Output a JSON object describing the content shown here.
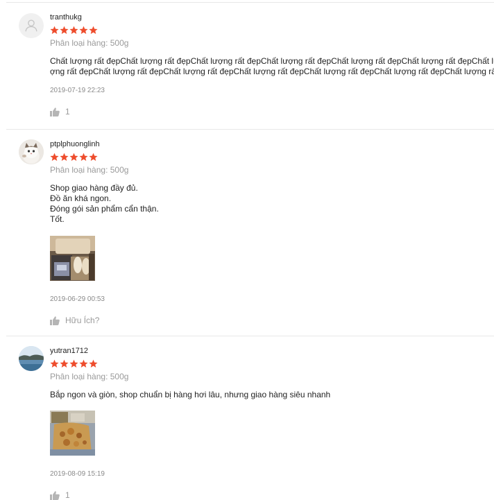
{
  "reviews": [
    {
      "username": "tranthukg",
      "rating": 5,
      "variation": "Phân loại hàng: 500g",
      "comment": "Chất lượng rất đẹpChất lượng rất đẹpChất lượng rất đẹpChất lượng rất đẹpChất lượng rất đẹpChất lượng rất đẹpChất lượng rất đẹpChất lượng rất đẹpChất lượng rất đẹpChất lượng rất đẹpChất lượng rất đẹpChất lượng rất đẹpChất lượng rất đẹpChất lượng rất đẹp",
      "timestamp": "2019-07-19 22:23",
      "like_label": "1",
      "avatar_icon": "default-user-icon"
    },
    {
      "username": "ptplphuonglinh",
      "rating": 5,
      "variation": "Phân loại hàng: 500g",
      "comment": "Shop giao hàng đầy đủ.\nĐồ ăn khá ngon.\nĐóng gói sản phẩm cẩn thận.\nTốt.",
      "timestamp": "2019-06-29 00:53",
      "like_label": "Hữu Ích?",
      "avatar_icon": "cat-avatar"
    },
    {
      "username": "yutran1712",
      "rating": 5,
      "variation": "Phân loại hàng: 500g",
      "comment": "Bắp ngon và giòn, shop chuẩn bị hàng hơi lâu, nhưng giao hàng siêu nhanh",
      "timestamp": "2019-08-09 15:19",
      "like_label": "1",
      "avatar_icon": "landscape-avatar"
    }
  ],
  "colors": {
    "star": "#ee4d2d",
    "muted": "#9a9a9a",
    "divider": "#e8e8e8"
  }
}
